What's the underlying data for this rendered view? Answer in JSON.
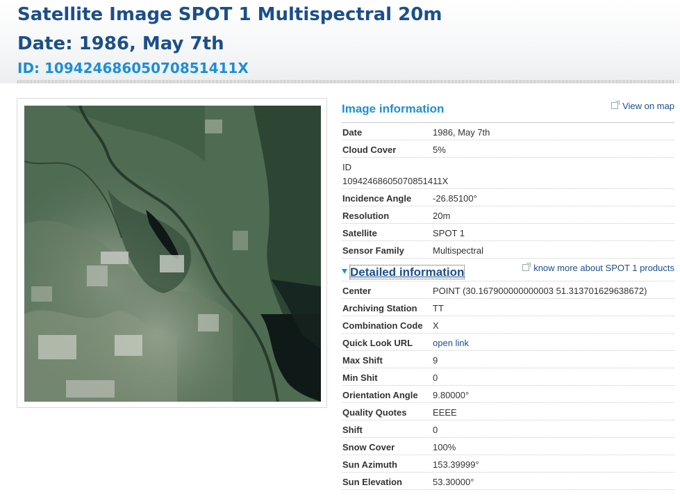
{
  "header": {
    "title": "Satellite Image SPOT 1 Multispectral 20m",
    "date_line": "Date: 1986, May 7th",
    "id_line": "ID: 1094246860507085141​1X"
  },
  "image_info": {
    "heading": "Image information",
    "map_link": "View on map",
    "rows": [
      {
        "label": "Date",
        "value": "1986, May 7th"
      },
      {
        "label": "Cloud Cover",
        "value": "5%"
      },
      {
        "label": "ID",
        "value": "10942468605070851411X"
      },
      {
        "label": "Incidence Angle",
        "value": "-26.85100°"
      },
      {
        "label": "Resolution",
        "value": "20m"
      },
      {
        "label": "Satellite",
        "value": "SPOT 1"
      },
      {
        "label": "Sensor Family",
        "value": "Multispectral"
      }
    ]
  },
  "details": {
    "heading": "Detailed information",
    "products_link": "know more about SPOT 1 products",
    "rows": [
      {
        "label": "Center",
        "value": "POINT (30.167900000000003 51.313701629638672)"
      },
      {
        "label": "Archiving Station",
        "value": "TT"
      },
      {
        "label": "Combination Code",
        "value": "X"
      },
      {
        "label": "Quick Look URL",
        "value": "open link"
      },
      {
        "label": "Max Shift",
        "value": "9"
      },
      {
        "label": "Min Shit",
        "value": "0"
      },
      {
        "label": "Orientation Angle",
        "value": "9.80000°"
      },
      {
        "label": "Quality Quotes",
        "value": "EEEE"
      },
      {
        "label": "Shift",
        "value": "0"
      },
      {
        "label": "Snow Cover",
        "value": "100%"
      },
      {
        "label": "Sun Azimuth",
        "value": "153.39999°"
      },
      {
        "label": "Sun Elevation",
        "value": "53.30000°"
      }
    ]
  },
  "colors": {
    "title": "#1b4f8a",
    "accent": "#1d8fd6",
    "link": "#1b4f8a"
  }
}
